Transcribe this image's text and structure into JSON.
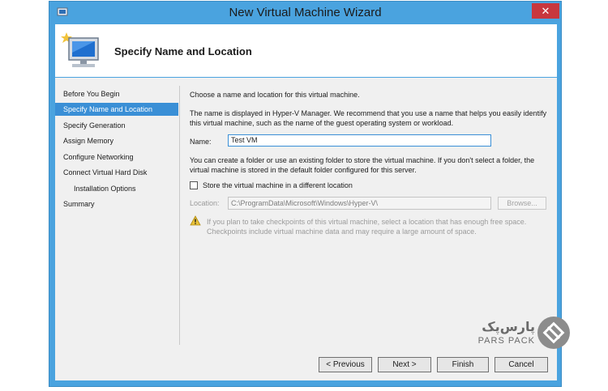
{
  "window": {
    "title": "New Virtual Machine Wizard",
    "close_glyph": "✕"
  },
  "header": {
    "title": "Specify Name and Location"
  },
  "nav": {
    "items": [
      {
        "label": "Before You Begin"
      },
      {
        "label": "Specify Name and Location"
      },
      {
        "label": "Specify Generation"
      },
      {
        "label": "Assign Memory"
      },
      {
        "label": "Configure Networking"
      },
      {
        "label": "Connect Virtual Hard Disk"
      },
      {
        "label": "Installation Options"
      },
      {
        "label": "Summary"
      }
    ],
    "selected_index": 1
  },
  "content": {
    "intro": "Choose a name and location for this virtual machine.",
    "name_help": "The name is displayed in Hyper-V Manager. We recommend that you use a name that helps you easily identify this virtual machine, such as the name of the guest operating system or workload.",
    "name_label": "Name:",
    "name_value": "Test VM",
    "folder_help": "You can create a folder or use an existing folder to store the virtual machine. If you don't select a folder, the virtual machine is stored in the default folder configured for this server.",
    "store_checkbox_label": "Store the virtual machine in a different location",
    "store_checked": false,
    "location_label": "Location:",
    "location_value": "C:\\ProgramData\\Microsoft\\Windows\\Hyper-V\\",
    "browse_label": "Browse...",
    "warning": "If you plan to take checkpoints of this virtual machine, select a location that has enough free space. Checkpoints include virtual machine data and may require a large amount of space."
  },
  "buttons": {
    "previous": "< Previous",
    "next": "Next >",
    "finish": "Finish",
    "cancel": "Cancel"
  },
  "watermark": {
    "fa": "پارس‌پک",
    "en": "PARS PACK"
  },
  "colors": {
    "frame": "#4aa3df",
    "selection": "#3a8fd6",
    "close": "#c8373e",
    "panel": "#f0f0f0"
  }
}
